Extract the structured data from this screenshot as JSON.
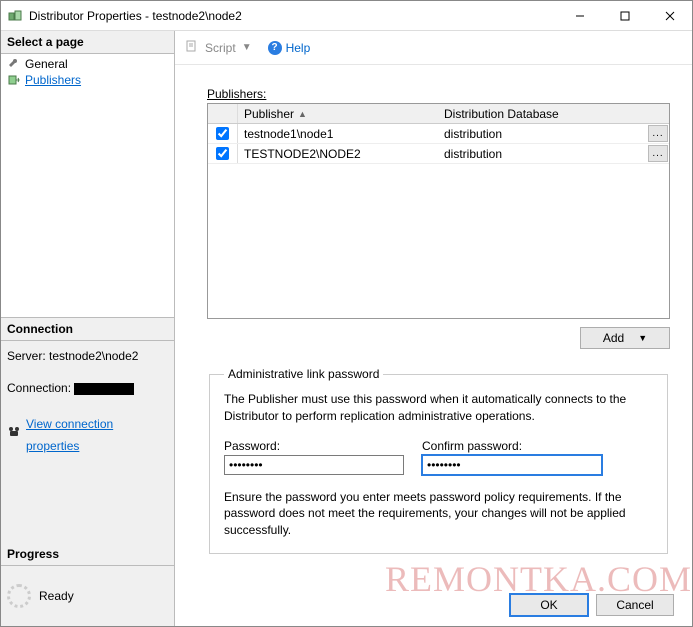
{
  "window": {
    "title": "Distributor Properties - testnode2\\node2"
  },
  "sidebar": {
    "selectPageHeader": "Select a page",
    "pages": [
      {
        "label": "General"
      },
      {
        "label": "Publishers"
      }
    ],
    "connectionHeader": "Connection",
    "serverLabel": "Server:",
    "serverValue": "testnode2\\node2",
    "connectionLabel": "Connection:",
    "viewConnPropsLabel": "View connection properties",
    "progressHeader": "Progress",
    "progressStatus": "Ready"
  },
  "toolbar": {
    "scriptLabel": "Script",
    "helpLabel": "Help"
  },
  "publishers": {
    "sectionLabel": "Publishers:",
    "headerPublisher": "Publisher",
    "headerDb": "Distribution Database",
    "rows": [
      {
        "checked": true,
        "publisher": "testnode1\\node1",
        "db": "distribution"
      },
      {
        "checked": true,
        "publisher": "TESTNODE2\\NODE2",
        "db": "distribution"
      }
    ],
    "addLabel": "Add"
  },
  "admin": {
    "legend": "Administrative link password",
    "hint": "The Publisher must use this password when it automatically connects to the Distributor to perform replication administrative operations.",
    "passwordLabel": "Password:",
    "confirmLabel": "Confirm password:",
    "passwordValue": "••••••••",
    "confirmValue": "••••••••",
    "note": "Ensure the password you enter meets password policy requirements. If the password does not meet the requirements, your changes will not be applied successfully."
  },
  "buttons": {
    "ok": "OK",
    "cancel": "Cancel"
  },
  "watermark": "REMONTKA.COM"
}
